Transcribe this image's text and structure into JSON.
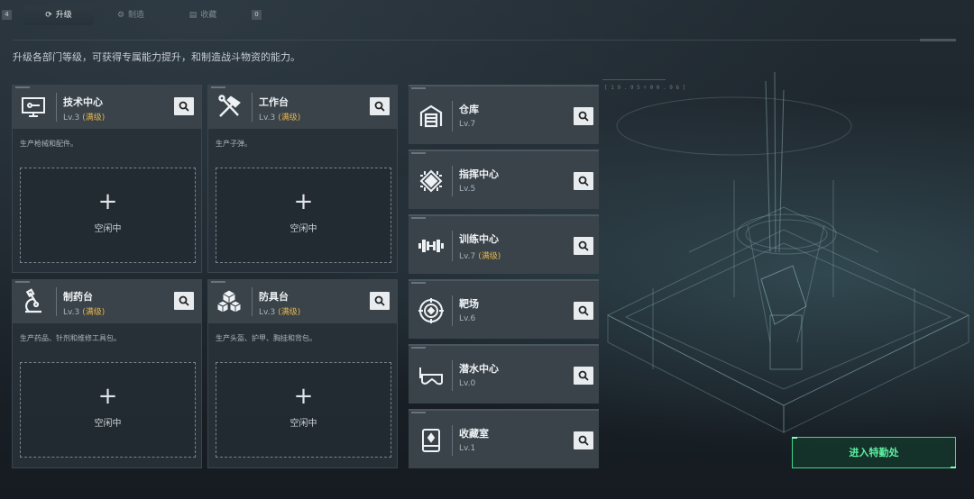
{
  "tabs": {
    "key_left": "4",
    "key_right": "0",
    "items": [
      {
        "label": "升级",
        "icon": "upgrade-icon",
        "active": true
      },
      {
        "label": "制造",
        "icon": "craft-icon",
        "active": false
      },
      {
        "label": "收藏",
        "icon": "collection-icon",
        "active": false
      }
    ]
  },
  "subtitle": "升级各部门等级，可获得专属能力提升，和制造战斗物资的能力。",
  "production_cards": [
    {
      "name": "技术中心",
      "level": "Lv.3",
      "max_tag": "(满级)",
      "desc": "生产枪械和配件。",
      "slot_plus": "+",
      "slot_label": "空闲中",
      "icon": "computer-icon"
    },
    {
      "name": "工作台",
      "level": "Lv.3",
      "max_tag": "(满级)",
      "desc": "生产子弹。",
      "slot_plus": "+",
      "slot_label": "空闲中",
      "icon": "tools-icon"
    },
    {
      "name": "制药台",
      "level": "Lv.3",
      "max_tag": "(满级)",
      "desc": "生产药品、针剂和维修工具包。",
      "slot_plus": "+",
      "slot_label": "空闲中",
      "icon": "microscope-icon"
    },
    {
      "name": "防具台",
      "level": "Lv.3",
      "max_tag": "(满级)",
      "desc": "生产头盔、护甲、胸挂和背包。",
      "slot_plus": "+",
      "slot_label": "空闲中",
      "icon": "boxes-icon"
    }
  ],
  "facilities": [
    {
      "name": "仓库",
      "level": "Lv.7",
      "max_tag": "",
      "icon": "warehouse-icon"
    },
    {
      "name": "指挥中心",
      "level": "Lv.5",
      "max_tag": "",
      "icon": "chip-icon"
    },
    {
      "name": "训练中心",
      "level": "Lv.7",
      "max_tag": "(满级)",
      "icon": "dumbbell-icon"
    },
    {
      "name": "靶场",
      "level": "Lv.6",
      "max_tag": "",
      "icon": "target-icon"
    },
    {
      "name": "潜水中心",
      "level": "Lv.0",
      "max_tag": "",
      "icon": "diving-mask-icon"
    },
    {
      "name": "收藏室",
      "level": "Lv.1",
      "max_tag": "",
      "icon": "display-case-icon"
    }
  ],
  "hud_coordinate": "[ 1 9 . 9 5 ÷ 0 0 . 9 6 ]",
  "enter_button": "进入特勤处",
  "colors": {
    "max_level": "#e5b44c",
    "accent_green": "#3ed88a"
  }
}
